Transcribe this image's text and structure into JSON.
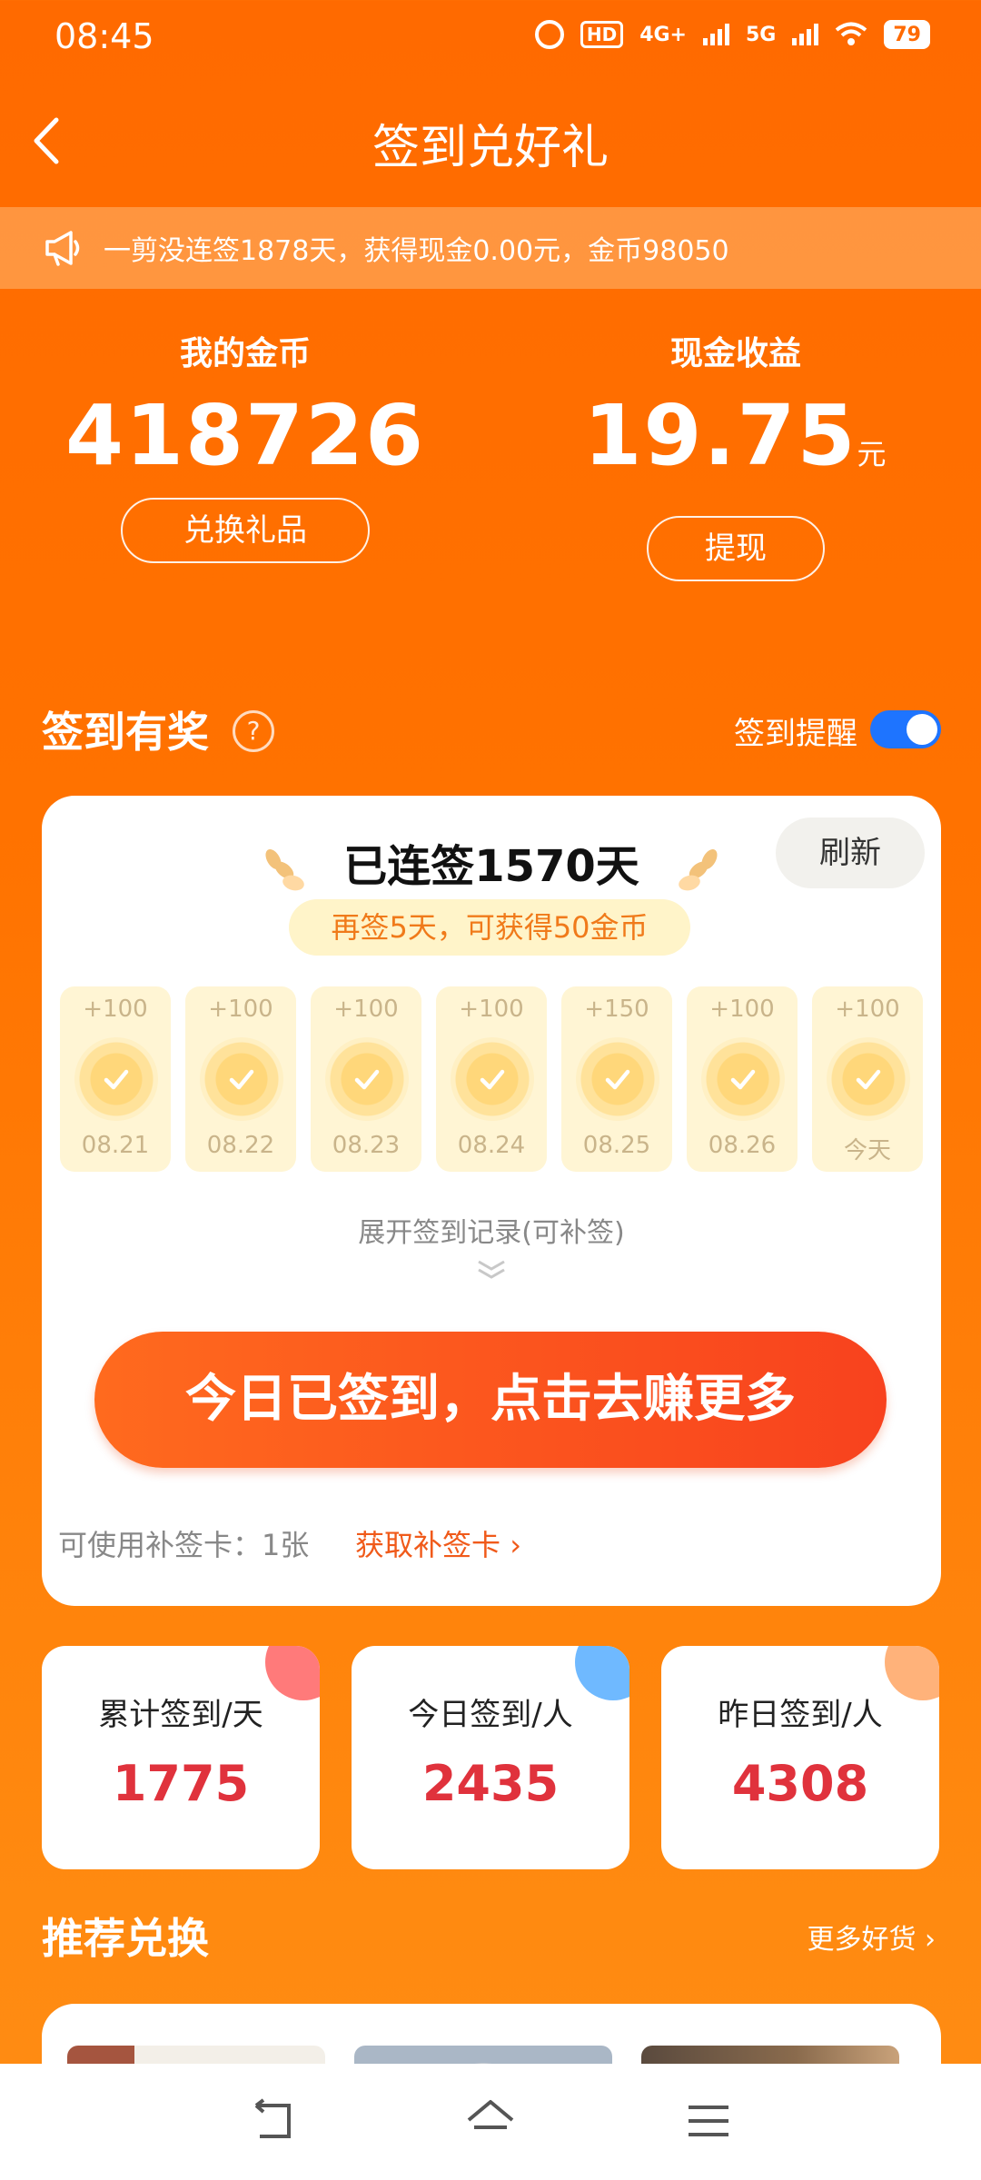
{
  "status_bar": {
    "time": "08:45",
    "hd_label": "HD",
    "net1": "4G+",
    "net2": "5G",
    "battery": "79"
  },
  "header": {
    "title": "签到兑好礼",
    "back_icon": "chevron-left-icon"
  },
  "notice": {
    "icon": "megaphone-icon",
    "text": "一剪没连签1878天，获得现金0.00元，金币98050"
  },
  "balances": {
    "coins_label": "我的金币",
    "coins_value": "418726",
    "redeem_button": "兑换礼品",
    "cash_label": "现金收益",
    "cash_value": "19.75",
    "cash_unit": "元",
    "withdraw_button": "提现"
  },
  "sign_section": {
    "title": "签到有奖",
    "help_icon": "?",
    "reminder_label": "签到提醒",
    "reminder_enabled": true,
    "toggle_color": "#1e74ff"
  },
  "sign_card": {
    "streak_text": "已连签1570天",
    "refresh_button": "刷新",
    "streak_tip": "再签5天，可获得50金币",
    "days": [
      {
        "reward": "+100",
        "date": "08.21",
        "checked": true
      },
      {
        "reward": "+100",
        "date": "08.22",
        "checked": true
      },
      {
        "reward": "+100",
        "date": "08.23",
        "checked": true
      },
      {
        "reward": "+100",
        "date": "08.24",
        "checked": true
      },
      {
        "reward": "+150",
        "date": "08.25",
        "checked": true
      },
      {
        "reward": "+100",
        "date": "08.26",
        "checked": true
      },
      {
        "reward": "+100",
        "date": "今天",
        "checked": true
      }
    ],
    "expand_link": "展开签到记录(可补签)",
    "cta_button": "今日已签到，点击去赚更多",
    "makeup_label": "可使用补签卡：1张",
    "makeup_link": "获取补签卡"
  },
  "stats": [
    {
      "label": "累计签到/天",
      "value": "1775",
      "dot_color": "#ff7a7a"
    },
    {
      "label": "今日签到/人",
      "value": "2435",
      "dot_color": "#6fb9ff"
    },
    {
      "label": "昨日签到/人",
      "value": "4308",
      "dot_color": "#ffb27a"
    }
  ],
  "recommend": {
    "title": "推荐兑换",
    "more_link": "更多好货"
  },
  "colors": {
    "background": "#ff7000",
    "accent_red": "#e0323c",
    "cta": "#f8421e"
  }
}
